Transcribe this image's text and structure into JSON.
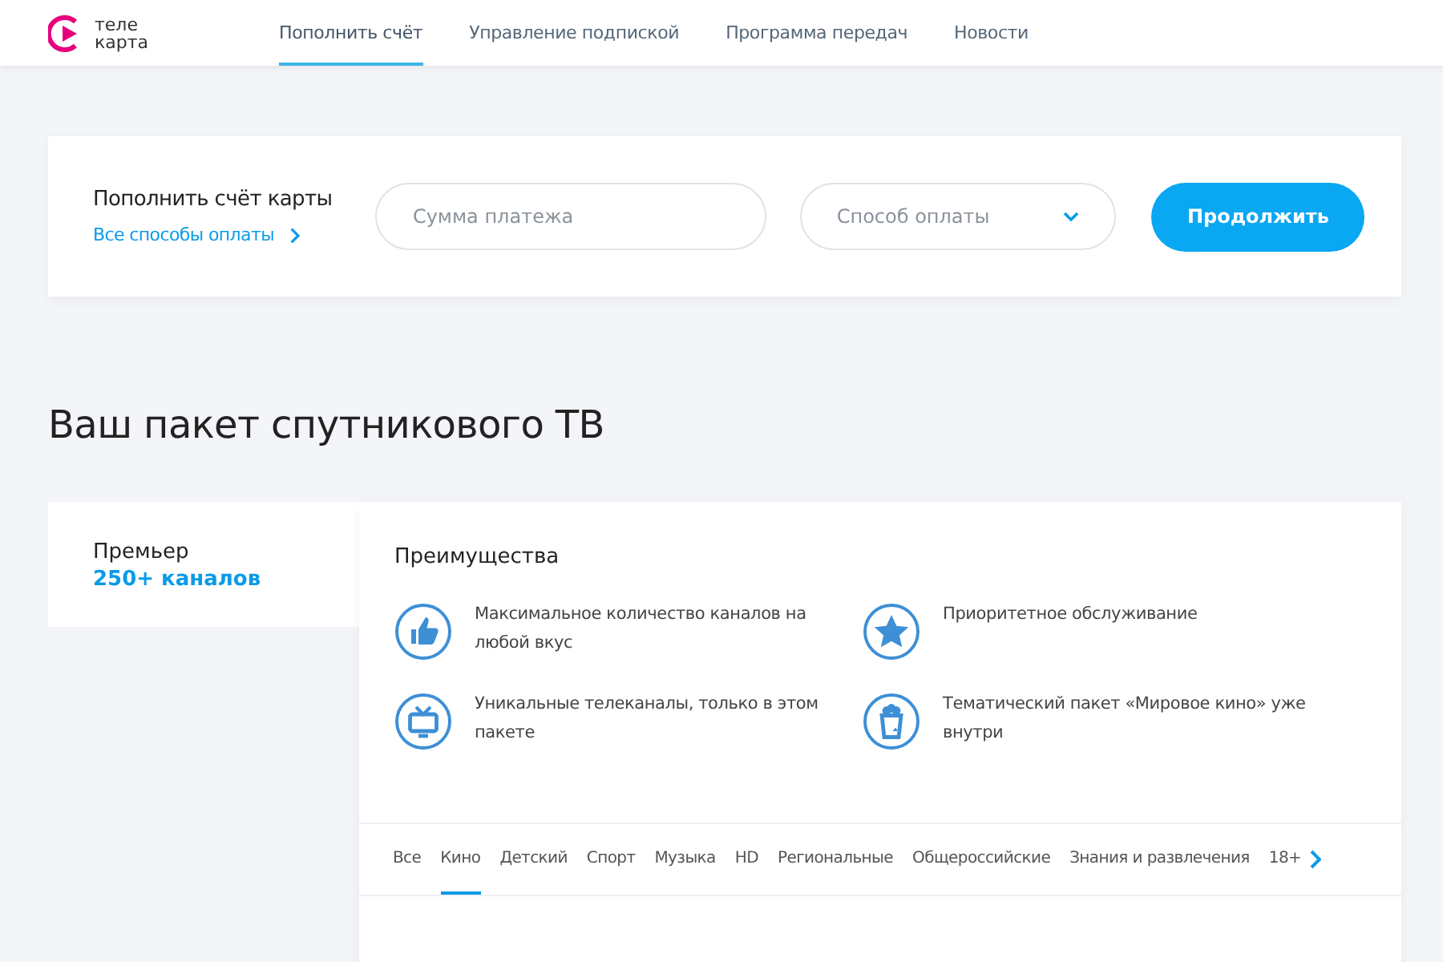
{
  "header": {
    "logo_text": [
      "теле",
      "карта"
    ],
    "nav": [
      {
        "label": "Пополнить счёт",
        "selected": true
      },
      {
        "label": "Управление подпиской",
        "selected": false
      },
      {
        "label": "Программа передач",
        "selected": false
      },
      {
        "label": "Новости",
        "selected": false
      }
    ]
  },
  "payment": {
    "title": "Пополнить счёт карты",
    "link": "Все способы оплаты",
    "amount": {
      "placeholder": "Сумма платежа"
    },
    "method": {
      "placeholder": "Способ оплаты"
    },
    "button": "Продолжить"
  },
  "heading": "Ваш пакет спутникового ТВ",
  "package": {
    "name": "Премьер",
    "channels": "250+ каналов"
  },
  "benefits": {
    "title": "Преимущества",
    "items": [
      {
        "kind": "thumb",
        "text": "Максимальное количество каналов на любой вкус"
      },
      {
        "kind": "star",
        "text": "Приоритетное обслуживание"
      },
      {
        "kind": "tv",
        "text": "Уникальные телеканалы, только в этом пакете"
      },
      {
        "kind": "popcorn",
        "text": "Тематический пакет «Мировое кино» уже внутри"
      }
    ]
  },
  "categories": [
    {
      "label": "Все",
      "selected": false
    },
    {
      "label": "Кино",
      "selected": true
    },
    {
      "label": "Детский",
      "selected": false
    },
    {
      "label": "Спорт",
      "selected": false
    },
    {
      "label": "Музыка",
      "selected": false
    },
    {
      "label": "HD",
      "selected": false
    },
    {
      "label": "Региональные",
      "selected": false
    },
    {
      "label": "Общероссийские",
      "selected": false
    },
    {
      "label": "Знания и развлечения",
      "selected": false
    },
    {
      "label": "18+",
      "selected": false
    }
  ]
}
